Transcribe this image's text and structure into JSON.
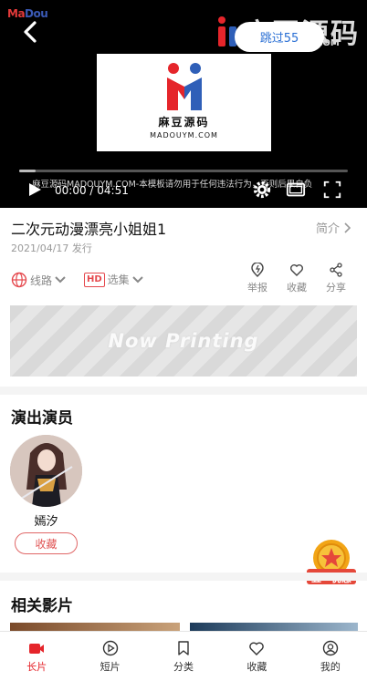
{
  "player": {
    "corner_logo_a": "Ma",
    "corner_logo_b": "Dou",
    "watermark_text": "麻豆源码",
    "watermark_sub": "COM",
    "skip_label": "跳过55",
    "logo_cn": "麻豆源码",
    "logo_en": "MADOUYM.COM",
    "marquee_text": "麻豆源码MADOUYM.COM-本模板请勿用于任何违法行为，否则后果自负",
    "time_label": "00:00 / 04:51",
    "progress_fraction": 0.0,
    "logo_colors": {
      "red": "#e5252b",
      "blue": "#2f5fb8"
    }
  },
  "video": {
    "title": "二次元动漫漂亮小姐姐1",
    "intro_label": "简介",
    "date_label": "2021/04/17 发行"
  },
  "options": {
    "route_label": "线路",
    "episodes_label": "选集",
    "hd_badge": "HD"
  },
  "actions": {
    "report": "举报",
    "favorite": "收藏",
    "share": "分享"
  },
  "banner": {
    "text": "Now Printing"
  },
  "cast": {
    "heading": "演出演员",
    "actor_name": "嫣汐",
    "favorite_label": "收藏"
  },
  "promo": {
    "label": "五一优惠"
  },
  "related": {
    "heading": "相关影片"
  },
  "tabbar": {
    "tabs": [
      {
        "label": "长片",
        "icon": "video-icon"
      },
      {
        "label": "短片",
        "icon": "play-circle-icon"
      },
      {
        "label": "分类",
        "icon": "bookmark-icon"
      },
      {
        "label": "收藏",
        "icon": "heart-icon"
      },
      {
        "label": "我的",
        "icon": "user-icon"
      }
    ],
    "active_color": "#e5252b"
  }
}
